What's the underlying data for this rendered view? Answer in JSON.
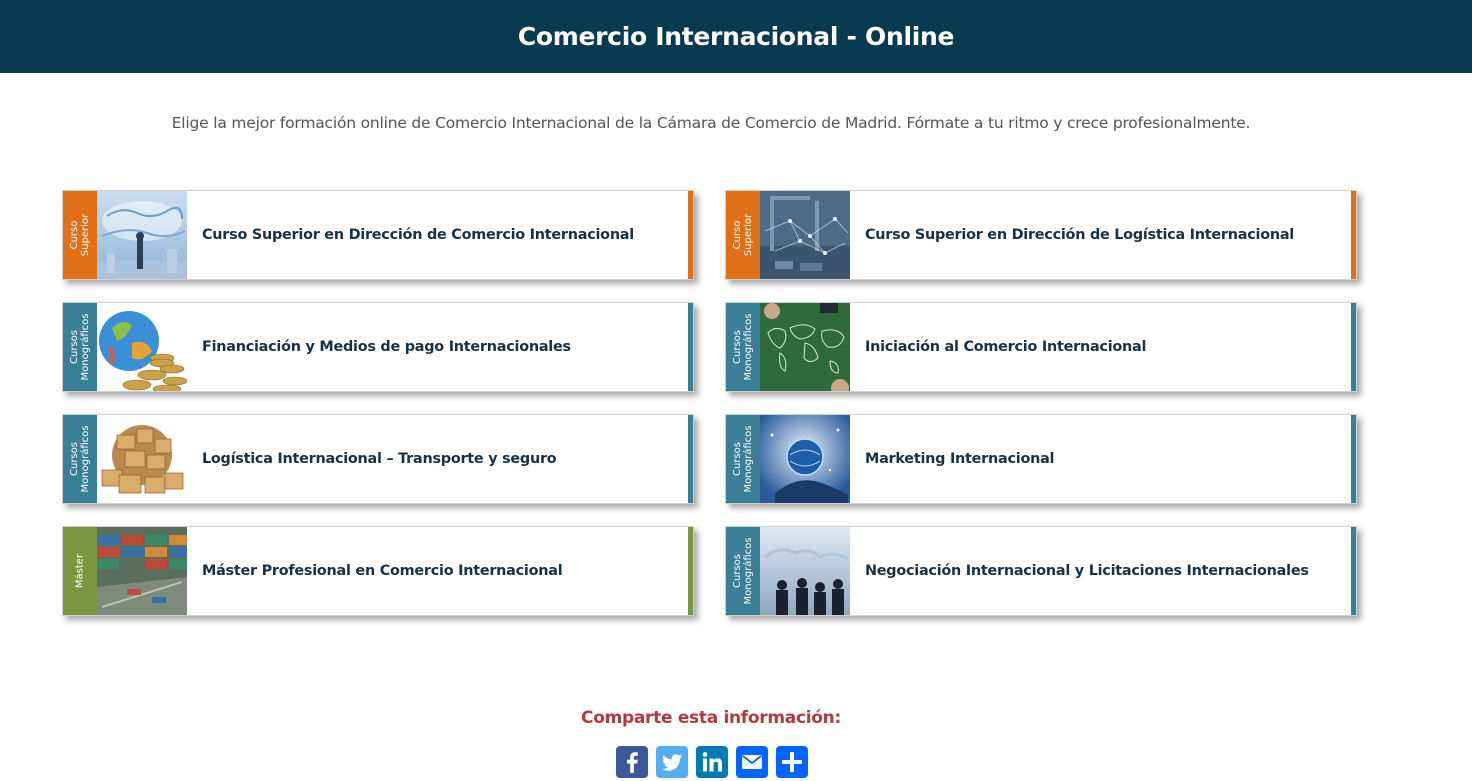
{
  "header": {
    "title": "Comercio Internacional - Online"
  },
  "intro": {
    "text": "Elige la mejor formación online de Comercio Internacional de la Cámara de Comercio de Madrid. Fórmate a tu ritmo y crece profesionalmente."
  },
  "colors": {
    "header_bg": "#093a4f",
    "superior": "#e07018",
    "monografico": "#3a7f98",
    "master": "#7a9640",
    "share_title": "#b33a3a"
  },
  "courses": [
    {
      "category": "Curso\nSuperior",
      "title": "Curso Superior en Dirección de Comercio Internacional",
      "image": "business-globe-image"
    },
    {
      "category": "Curso\nSuperior",
      "title": "Curso Superior en Dirección de Logística Internacional",
      "image": "port-network-image"
    },
    {
      "category": "Cursos\nMonográficos",
      "title": "Financiación y Medios de pago Internacionales",
      "image": "globe-coins-image"
    },
    {
      "category": "Cursos\nMonográficos",
      "title": "Iniciación al Comercio Internacional",
      "image": "world-map-table-image"
    },
    {
      "category": "Cursos\nMonográficos",
      "title": "Logística Internacional – Transporte y seguro",
      "image": "globe-boxes-image"
    },
    {
      "category": "Cursos\nMonográficos",
      "title": "Marketing Internacional",
      "image": "digital-globe-hand-image"
    },
    {
      "category": "Máster",
      "title": "Máster Profesional en Comercio Internacional",
      "image": "container-port-image"
    },
    {
      "category": "Cursos\nMonográficos",
      "title": "Negociación Internacional y Licitaciones Internacionales",
      "image": "business-silhouettes-image"
    }
  ],
  "share": {
    "title": "Comparte esta información:",
    "buttons": [
      {
        "icon": "facebook-icon",
        "color": "#3b5998"
      },
      {
        "icon": "twitter-icon",
        "color": "#55acee"
      },
      {
        "icon": "linkedin-icon",
        "color": "#007bb5"
      },
      {
        "icon": "email-icon",
        "color": "#0166ff"
      },
      {
        "icon": "share-plus-icon",
        "color": "#0166ff"
      }
    ]
  }
}
